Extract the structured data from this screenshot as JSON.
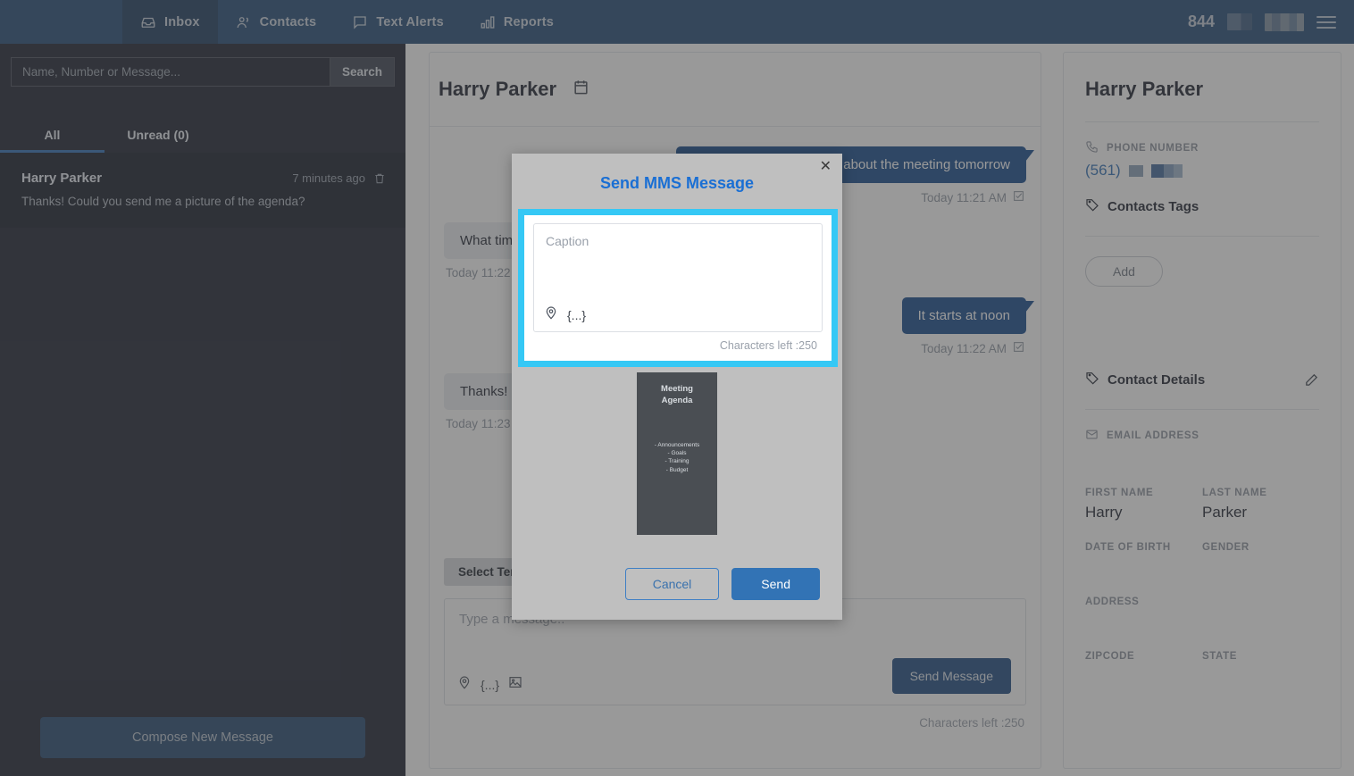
{
  "topnav": {
    "items": [
      {
        "label": "Inbox",
        "icon": "inbox-icon",
        "active": true
      },
      {
        "label": "Contacts",
        "icon": "contacts-icon",
        "active": false
      },
      {
        "label": "Text Alerts",
        "icon": "chat-bubble-icon",
        "active": false
      },
      {
        "label": "Reports",
        "icon": "bar-chart-icon",
        "active": false
      }
    ],
    "account_number": "844",
    "menu_icon": "hamburger-menu-icon"
  },
  "sidebar": {
    "search": {
      "placeholder": "Name, Number or Message...",
      "value": "",
      "button_label": "Search"
    },
    "tabs": [
      {
        "label": "All",
        "active": true
      },
      {
        "label": "Unread (0)",
        "active": false
      }
    ],
    "conversations": [
      {
        "name": "Harry Parker",
        "time": "7 minutes ago",
        "snippet": "Thanks! Could you send me a picture of the agenda?",
        "delete_icon": "trash-icon"
      }
    ],
    "compose_label": "Compose New Message"
  },
  "conversation": {
    "title": "Harry Parker",
    "calendar_icon": "calendar-icon",
    "messages": [
      {
        "direction": "out",
        "text": "Hi Harry, just checking in about the meeting tomorrow",
        "stamp": "Today 11:21 AM",
        "status_icon": "check-square-icon"
      },
      {
        "direction": "in",
        "text": "What time does it start?",
        "stamp": "Today 11:22 AM",
        "status_icon": ""
      },
      {
        "direction": "out",
        "text": "It starts at noon",
        "stamp": "Today 11:22 AM",
        "status_icon": "check-square-icon"
      },
      {
        "direction": "in",
        "text": "Thanks! Could you send me a picture of the agenda?",
        "stamp": "Today 11:23 AM",
        "status_icon": ""
      }
    ],
    "template_button": "Select Template",
    "composer": {
      "placeholder": "Type a message..",
      "value": "",
      "merge_token": "{...}",
      "location_icon": "location-pin-icon",
      "image_icon": "image-attach-icon",
      "send_label": "Send Message",
      "chars_left": "Characters left :250"
    }
  },
  "contact_panel": {
    "name": "Harry Parker",
    "phone_label": "PHONE NUMBER",
    "phone_icon": "phone-icon",
    "phone_prefix": "(561)",
    "tags_label": "Contacts Tags",
    "tags_icon": "tag-icon",
    "add_label": "Add",
    "details_label": "Contact Details",
    "details_icon": "tag-icon",
    "edit_icon": "pencil-edit-icon",
    "email_label": "EMAIL ADDRESS",
    "email_icon": "envelope-icon",
    "email_value": "",
    "fields": [
      {
        "label": "FIRST NAME",
        "value": "Harry"
      },
      {
        "label": "LAST NAME",
        "value": "Parker"
      },
      {
        "label": "DATE OF BIRTH",
        "value": ""
      },
      {
        "label": "GENDER",
        "value": ""
      },
      {
        "label": "ADDRESS",
        "value": ""
      },
      {
        "label": "ZIPCODE",
        "value": ""
      },
      {
        "label": "STATE",
        "value": ""
      }
    ]
  },
  "modal": {
    "title": "Send MMS Message",
    "close_icon": "close-x-icon",
    "caption_placeholder": "Caption",
    "caption_value": "",
    "merge_token": "{...}",
    "location_icon": "location-pin-icon",
    "chars_left": "Characters left :250",
    "attachment_preview": {
      "title_line1": "Meeting",
      "title_line2": "Agenda",
      "items": "- Announcements\n- Goals\n- Training\n- Budget"
    },
    "cancel_label": "Cancel",
    "send_label": "Send"
  },
  "colors": {
    "topbar": "#234a77",
    "sidebar": "#1b2130",
    "accent_blue": "#2f6fb5",
    "bubble_out": "#154a8c",
    "focus_ring": "#35c8f5",
    "modal_bg": "#bfbfbf",
    "modal_title": "#1a6fd4"
  }
}
